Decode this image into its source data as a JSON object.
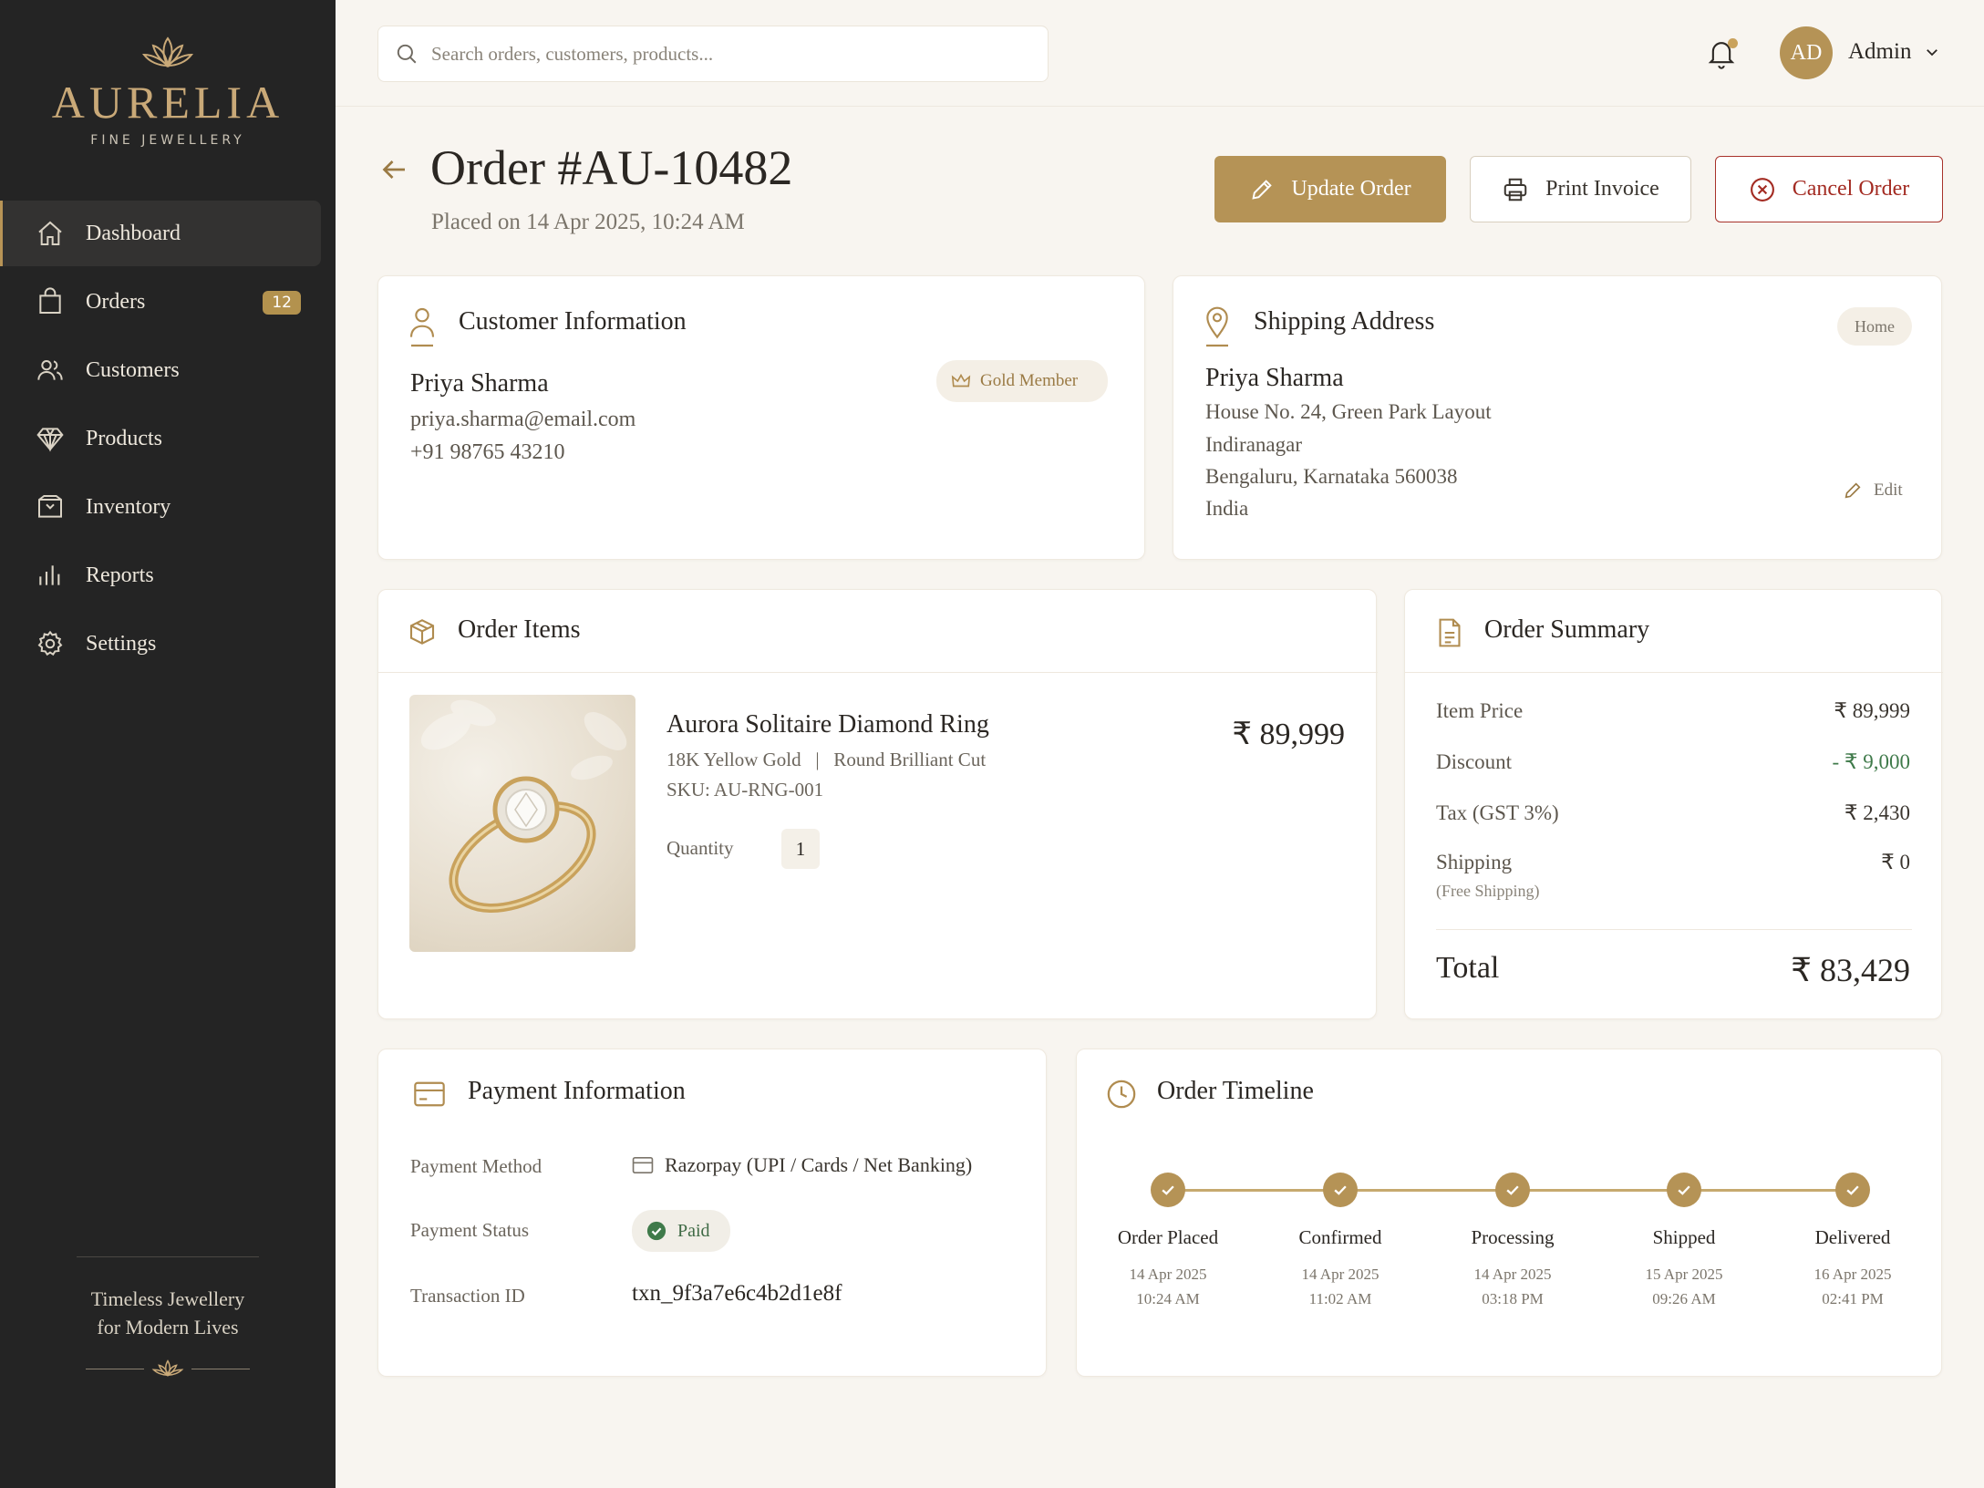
{
  "brand": {
    "name": "AURELIA",
    "tagline": "FINE JEWELLERY",
    "footer_tagline_1": "Timeless Jewellery",
    "footer_tagline_2": "for Modern Lives"
  },
  "nav": [
    {
      "label": "Dashboard",
      "icon": "home-icon",
      "active": true
    },
    {
      "label": "Orders",
      "icon": "shopping-bag-icon",
      "badge": "12"
    },
    {
      "label": "Customers",
      "icon": "users-icon"
    },
    {
      "label": "Products",
      "icon": "diamond-icon"
    },
    {
      "label": "Inventory",
      "icon": "box-icon"
    },
    {
      "label": "Reports",
      "icon": "bar-chart-icon"
    },
    {
      "label": "Settings",
      "icon": "gear-icon"
    }
  ],
  "topbar": {
    "search_placeholder": "Search orders, customers, products...",
    "avatar_initials": "AD",
    "user": "Admin"
  },
  "header": {
    "title": "Order #AU-10482",
    "placed": "Placed on 14 Apr 2025, 10:24 AM"
  },
  "actions": {
    "update": "Update Order",
    "print": "Print Invoice",
    "cancel": "Cancel Order"
  },
  "customer": {
    "title": "Customer Information",
    "name": "Priya Sharma",
    "email": "priya.sharma@email.com",
    "phone": "+91 98765 43210",
    "membership": "Gold Member"
  },
  "shipping": {
    "title": "Shipping Address",
    "tag": "Home",
    "name": "Priya Sharma",
    "line1": "House No. 24, Green Park Layout",
    "line2": "Indiranagar",
    "line3": "Bengaluru, Karnataka 560038",
    "line4": "India",
    "edit": "Edit"
  },
  "items": {
    "title": "Order Items",
    "product": "Aurora Solitaire Diamond Ring",
    "specs": "18K Yellow Gold   |   Round Brilliant Cut",
    "sku": "SKU: AU-RNG-001",
    "quantity_label": "Quantity",
    "quantity": "1",
    "price": "₹ 89,999"
  },
  "summary": {
    "title": "Order Summary",
    "rows": [
      {
        "label": "Item Price",
        "value": "₹ 89,999"
      },
      {
        "label": "Discount",
        "value": "- ₹ 9,000"
      },
      {
        "label": "Tax (GST 3%)",
        "value": "₹ 2,430"
      },
      {
        "label": "Shipping",
        "value": "₹ 0",
        "note": "(Free Shipping)"
      }
    ],
    "total_label": "Total",
    "total_value": "₹ 83,429",
    "discount_color": "#3f7a4a"
  },
  "payment": {
    "title": "Payment Information",
    "method_label": "Payment Method",
    "method": "Razorpay (UPI / Cards / Net Banking)",
    "status_label": "Payment Status",
    "status": "Paid",
    "txn_label": "Transaction ID",
    "txn": "txn_9f3a7e6c4b2d1e8f"
  },
  "timeline": {
    "title": "Order Timeline",
    "steps": [
      {
        "label": "Order Placed",
        "date": "14 Apr 2025",
        "time": "10:24 AM"
      },
      {
        "label": "Confirmed",
        "date": "14 Apr 2025",
        "time": "11:02 AM"
      },
      {
        "label": "Processing",
        "date": "14 Apr 2025",
        "time": "03:18 PM"
      },
      {
        "label": "Shipped",
        "date": "15 Apr 2025",
        "time": "09:26 AM"
      },
      {
        "label": "Delivered",
        "date": "16 Apr 2025",
        "time": "02:41 PM"
      }
    ]
  },
  "colors": {
    "accent": "#b59356",
    "sidebar": "#242424",
    "danger": "#a32b22",
    "success": "#3f7a4a"
  }
}
